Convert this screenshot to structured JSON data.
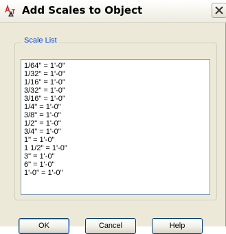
{
  "window": {
    "title": "Add Scales to Object"
  },
  "group": {
    "label": "Scale List"
  },
  "scale_list": {
    "items": [
      "1/64\" = 1'-0\"",
      "1/32\" = 1'-0\"",
      "1/16\" = 1'-0\"",
      "3/32\" = 1'-0\"",
      "3/16\" = 1'-0\"",
      "1/4\" = 1'-0\"",
      "3/8\" = 1'-0\"",
      "1/2\" = 1'-0\"",
      "3/4\" = 1'-0\"",
      "1\" = 1'-0\"",
      "1 1/2\" = 1'-0\"",
      "3\" = 1'-0\"",
      "6\" = 1'-0\"",
      "1'-0\" = 1'-0\""
    ]
  },
  "buttons": {
    "ok": "OK",
    "cancel": "Cancel",
    "help": "Help"
  },
  "icons": {
    "app": "autocad-annotative-icon",
    "close": "close-icon"
  },
  "colors": {
    "group_label": "#0046d5",
    "dialog_bg": "#ece9d8",
    "icon_red": "#d8232a"
  }
}
